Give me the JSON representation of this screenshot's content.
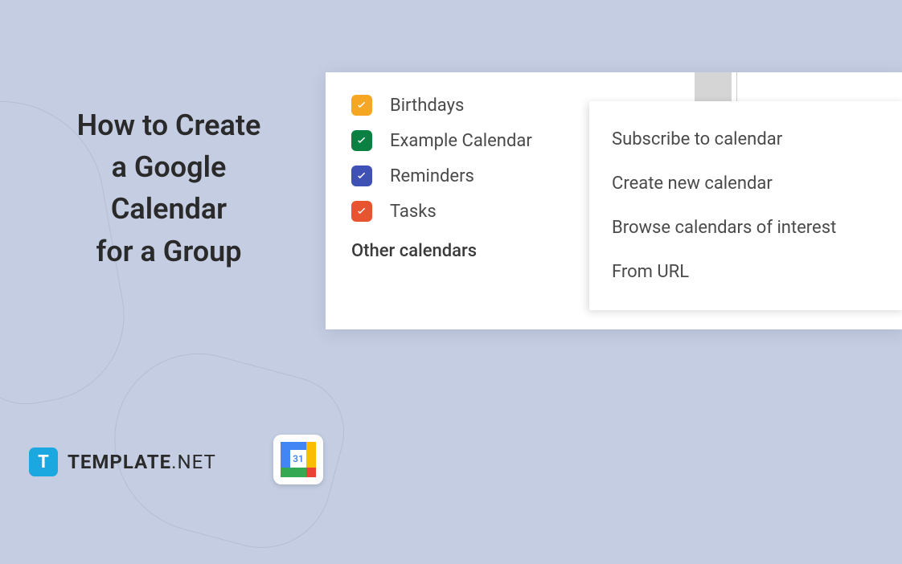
{
  "heading": {
    "line1": "How to Create",
    "line2": "a Google",
    "line3": "Calendar",
    "line4": "for a Group"
  },
  "calendars": [
    {
      "label": "Birthdays",
      "color": "orange"
    },
    {
      "label": "Example Calendar",
      "color": "green"
    },
    {
      "label": "Reminders",
      "color": "blue"
    },
    {
      "label": "Tasks",
      "color": "red"
    }
  ],
  "section_header": "Other calendars",
  "menu": [
    "Subscribe to calendar",
    "Create new calendar",
    "Browse calendars of interest",
    "From URL"
  ],
  "brand": {
    "icon_letter": "T",
    "name": "TEMPLATE",
    "suffix": ".NET"
  },
  "gcal_day": "31"
}
